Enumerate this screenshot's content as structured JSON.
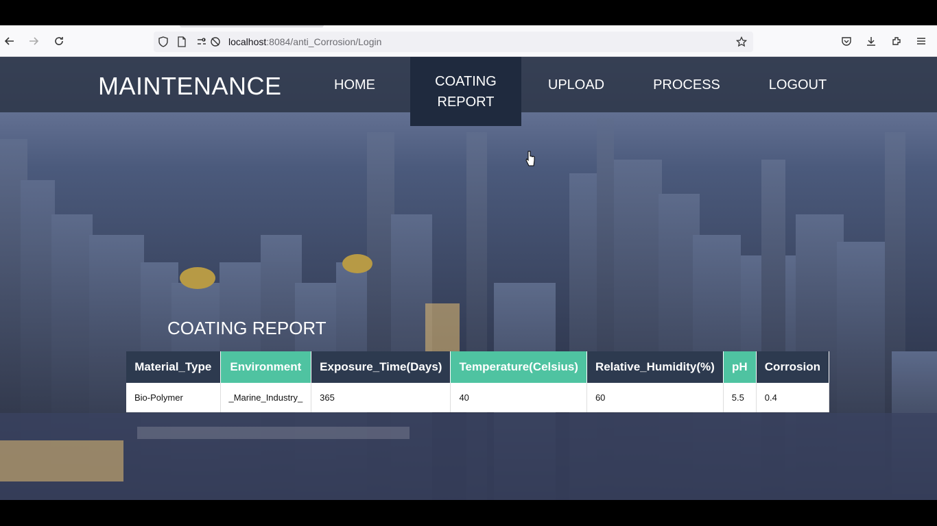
{
  "browser": {
    "url_host": "localhost",
    "url_path": ":8084/anti_Corrosion/Login"
  },
  "navbar": {
    "brand": "MAINTENANCE",
    "items": [
      {
        "label": "HOME"
      },
      {
        "label": "COATING\nREPORT",
        "line1": "COATING",
        "line2": "REPORT"
      },
      {
        "label": "UPLOAD"
      },
      {
        "label": "PROCESS"
      },
      {
        "label": "LOGOUT"
      }
    ]
  },
  "report": {
    "title": "COATING REPORT",
    "columns": [
      "Material_Type",
      "Environment",
      "Exposure_Time(Days)",
      "Temperature(Celsius)",
      "Relative_Humidity(%)",
      "pH",
      "Corrosion"
    ],
    "rows": [
      [
        "Bio-Polymer",
        "_Marine_Industry_",
        "365",
        "40",
        "60",
        "5.5",
        "0.4"
      ]
    ]
  },
  "colors": {
    "header_dark": "#2d3a4f",
    "header_green": "#4fc3a1",
    "navbar": "#2c3648"
  }
}
